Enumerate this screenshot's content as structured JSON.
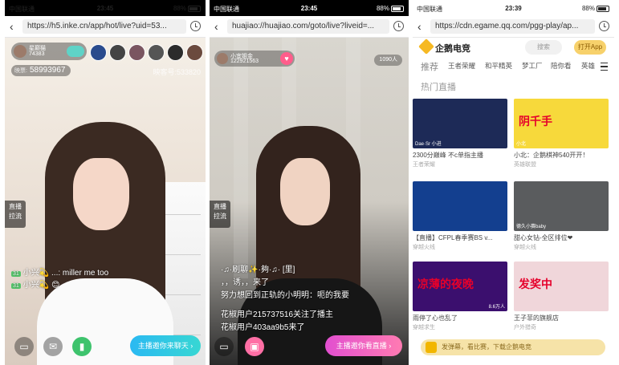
{
  "phones": {
    "inke": {
      "status": {
        "carrier": "中国联通",
        "time": "23:45",
        "battery": "88%"
      },
      "url": "https://h5.inke.cn/app/hot/live?uid=53...",
      "host": {
        "name": "星巅猫",
        "fans": "74383"
      },
      "coins_label": "映票:",
      "coins": "58993967",
      "room_id": "映客号:533820",
      "side_tag": "直播\n拉流",
      "chat": [
        {
          "level": "31",
          "text": "小兴💫 ...: miller me too"
        },
        {
          "level": "31",
          "text": "小兴💫 😊"
        }
      ],
      "cta": "主播邀你来聊天 ›"
    },
    "huajiao": {
      "status": {
        "carrier": "中国联通",
        "time": "23:45",
        "battery": "88%"
      },
      "url": "huajiao://huajiao.com/goto/live?liveid=...",
      "host": {
        "name": "小宜姐金",
        "id": "122921563"
      },
      "viewers": "1090人",
      "side_tag": "直播\n拉流",
      "chat": [
        "·♫·刷聊✨·夠·♫· [里]",
        "，，诱，，来了",
        "努力想回到正轨的小明明：呃的我要",
        "花椒用户215737516关注了播主",
        "花椒用户403aa9b5来了"
      ],
      "cta": "主播邀你看直播 ›"
    },
    "egame": {
      "status": {
        "carrier": "中国联通",
        "time": "23:39",
        "battery": "88%"
      },
      "url": "https://cdn.egame.qq.com/pgg-play/ap...",
      "brand": "企鹅电竞",
      "search": "搜索",
      "open_app": "打开App",
      "tabs": [
        "推荐",
        "王者荣耀",
        "和平精英",
        "梦工厂",
        "陪你看",
        "英雄"
      ],
      "section": "热门直播",
      "cards": [
        {
          "title": "2300分巅峰 不c单指主播",
          "category": "王者荣耀",
          "thumb_left": "Dae·Sr 小进",
          "thumb_right": "",
          "color": "#1d2a57",
          "big": ""
        },
        {
          "title": "小北：企鹅棋神540开开！",
          "category": "英雄联盟",
          "thumb_left": "小北",
          "thumb_right": "",
          "color": "#f7d93b",
          "big": "阴千手"
        },
        {
          "title": "【直播】CFPL春季赛BS v...",
          "category": "穿越火线",
          "thumb_left": "",
          "thumb_right": "",
          "color": "#133f8f",
          "big": ""
        },
        {
          "title": "甜心女钻-全区排位❤",
          "category": "穿越火线",
          "thumb_left": "德久小赛baby",
          "thumb_right": "",
          "color": "#5a5c5e",
          "big": ""
        },
        {
          "title": "雨停了心也乱了",
          "category": "穿越求生",
          "thumb_left": "",
          "thumb_right": "8.6万人",
          "color": "#3b0f6e",
          "big": "凉薄的夜晚"
        },
        {
          "title": "王子菲的旗舰店",
          "category": "户外猎奇",
          "thumb_left": "",
          "thumb_right": "",
          "color": "#f0d6da",
          "big": "发奖中"
        }
      ],
      "banner": "发弹幕，看比赛，下载企鹅电竞"
    }
  }
}
